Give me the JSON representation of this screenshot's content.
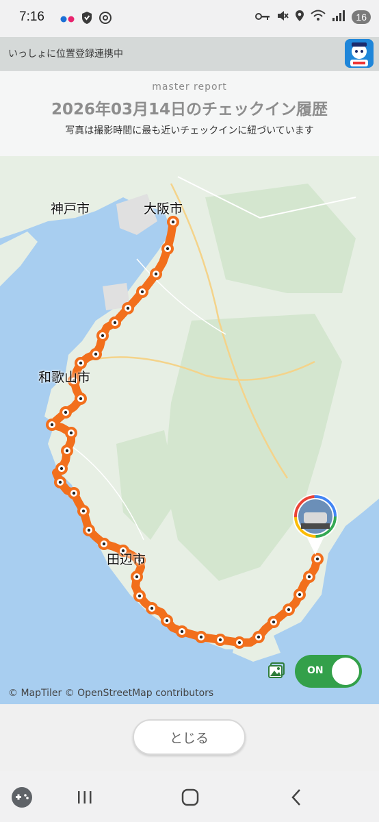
{
  "status_bar": {
    "time": "7:16",
    "badge": "16",
    "icons": [
      "flickr-icon",
      "shield-icon",
      "at-icon",
      "key-icon",
      "mute-icon",
      "location-icon",
      "wifi-icon",
      "signal-icon"
    ]
  },
  "app_header": {
    "title": "いっしょに位置登録連携中"
  },
  "report": {
    "kicker": "master report",
    "title": "2026年03月14日のチェックイン履歴",
    "note": "写真は撮影時間に最も近いチェックインに紐づいています"
  },
  "map": {
    "cities": {
      "kobe": "神戸市",
      "osaka": "大阪市",
      "wakayama": "和歌山市",
      "tanabe": "田辺市"
    },
    "attribution": "© MapTiler © OpenStreetMap contributors",
    "route_color": "#f26f1c",
    "sea_color": "#a8cef0",
    "land_color": "#e7efe4"
  },
  "photo_toggle": {
    "label": "ON",
    "state": "on",
    "color": "#33a04a"
  },
  "close_button": {
    "label": "とじる"
  },
  "nav_bar": {
    "icons": [
      "game-launcher-icon",
      "recent-apps-icon",
      "home-icon",
      "back-icon"
    ]
  }
}
